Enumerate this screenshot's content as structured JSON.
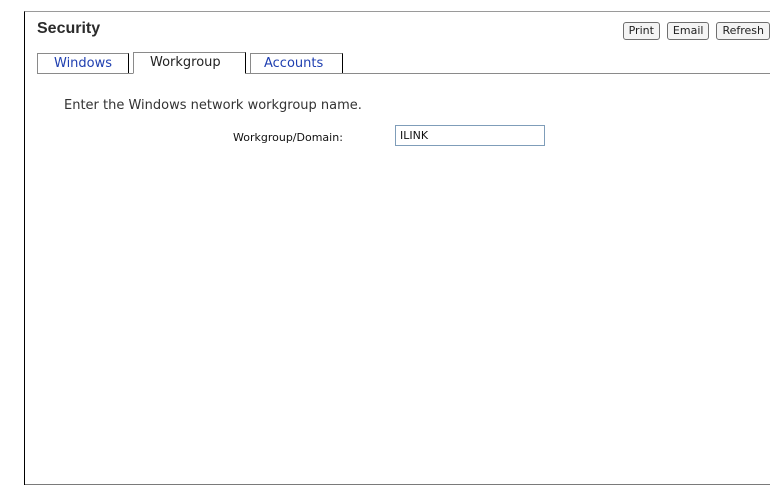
{
  "header": {
    "title": "Security",
    "toolbar": {
      "print_label": "Print",
      "email_label": "Email",
      "refresh_label": "Refresh"
    }
  },
  "tabs": [
    {
      "label": "Windows",
      "active": false
    },
    {
      "label": "Workgroup",
      "active": true
    },
    {
      "label": "Accounts",
      "active": false
    }
  ],
  "workgroup_panel": {
    "instruction": "Enter the Windows network workgroup name.",
    "field_label": "Workgroup/Domain:",
    "field_value": "ILINK"
  }
}
